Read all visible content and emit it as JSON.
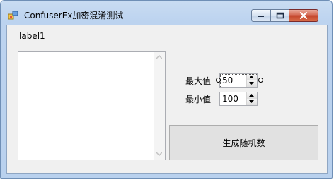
{
  "window": {
    "title": "ConfuserEx加密混淆测试"
  },
  "form": {
    "label1": "label1",
    "max_label": "最大值",
    "max_value": "50",
    "min_label": "最小值",
    "min_value": "100",
    "generate_button": "生成随机数"
  },
  "colors": {
    "close_button": "#c2442a",
    "client_background": "#f0f0f0",
    "button_background": "#e1e1e1"
  }
}
